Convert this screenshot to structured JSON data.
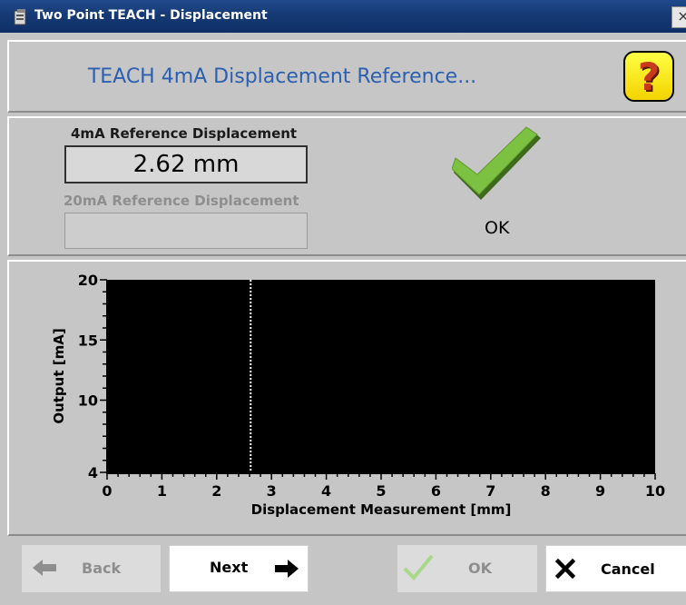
{
  "window": {
    "title": "Two Point TEACH - Displacement",
    "close_glyph": "×"
  },
  "header": {
    "title": "TEACH 4mA Displacement Reference...",
    "help_glyph": "?"
  },
  "reference": {
    "label_4ma": "4mA Reference Displacement",
    "value_4ma": "2.62 mm",
    "label_20ma": "20mA Reference Displacement",
    "value_20ma": "",
    "status": "OK"
  },
  "chart_data": {
    "type": "line",
    "xlabel": "Displacement Measurement [mm]",
    "ylabel": "Output [mA]",
    "xlim": [
      0,
      10
    ],
    "ylim": [
      4,
      20
    ],
    "x_ticks": [
      0,
      1,
      2,
      3,
      4,
      5,
      6,
      7,
      8,
      9,
      10
    ],
    "y_ticks": [
      4,
      10,
      15,
      20
    ],
    "marker_line": {
      "x": 2.62,
      "style": "dotted"
    },
    "plot_background": "#000000",
    "marker_color": "#ffffff"
  },
  "buttons": {
    "back": "Back",
    "next": "Next",
    "ok": "OK",
    "cancel": "Cancel"
  },
  "icons": {
    "title": "app-icon",
    "help": "help-icon",
    "check": "checkmark-icon",
    "back": "arrow-left-icon",
    "next": "arrow-right-icon",
    "ok": "checkmark-icon",
    "cancel": "x-icon"
  },
  "colors": {
    "title_bar": "#163a75",
    "header_text": "#2b5fb0",
    "check_green": "#7dc142",
    "disabled_text": "#8e8e8e"
  }
}
